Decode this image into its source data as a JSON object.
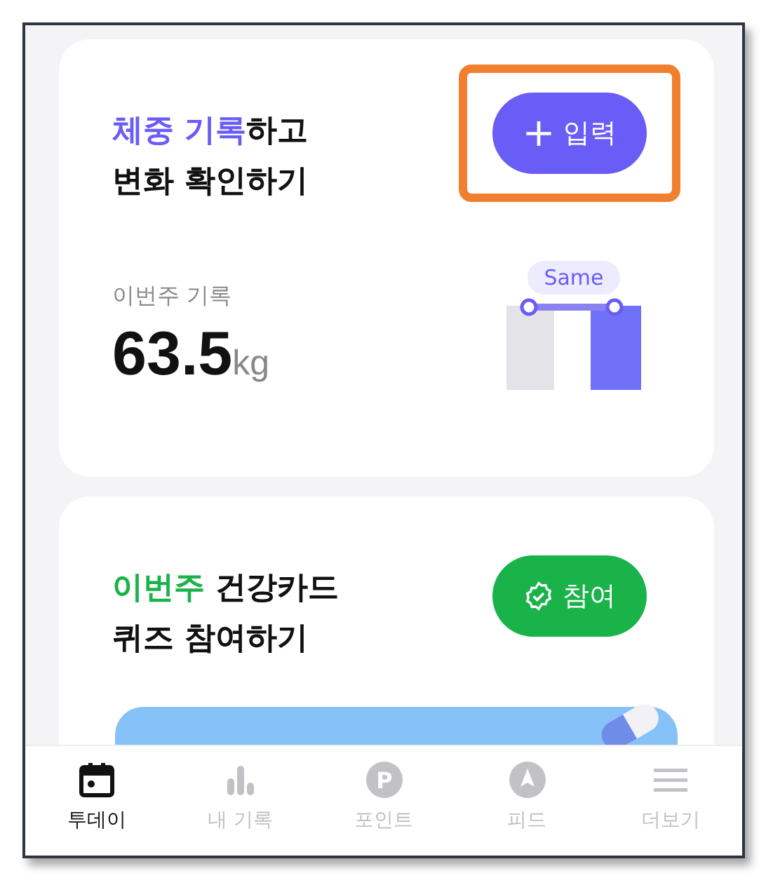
{
  "weight_card": {
    "title_accent": "체중 기록",
    "title_rest": "하고",
    "title_line2": "변화 확인하기",
    "button": {
      "label": "입력",
      "icon": "+",
      "highlighted": true
    },
    "record_label": "이번주 기록",
    "value": "63.5",
    "unit": "kg",
    "trend_badge": "Same"
  },
  "quiz_card": {
    "title_accent": "이번주",
    "title_rest": " 건강카드",
    "title_line2": "퀴즈 참여하기",
    "button": {
      "label": "참여",
      "highlighted": false
    }
  },
  "nav": [
    {
      "label": "투데이",
      "selected": true
    },
    {
      "label": "내 기록",
      "selected": false
    },
    {
      "label": "포인트",
      "badge": "P",
      "selected": false
    },
    {
      "label": "피드",
      "selected": false
    },
    {
      "label": "더보기",
      "selected": false
    }
  ]
}
